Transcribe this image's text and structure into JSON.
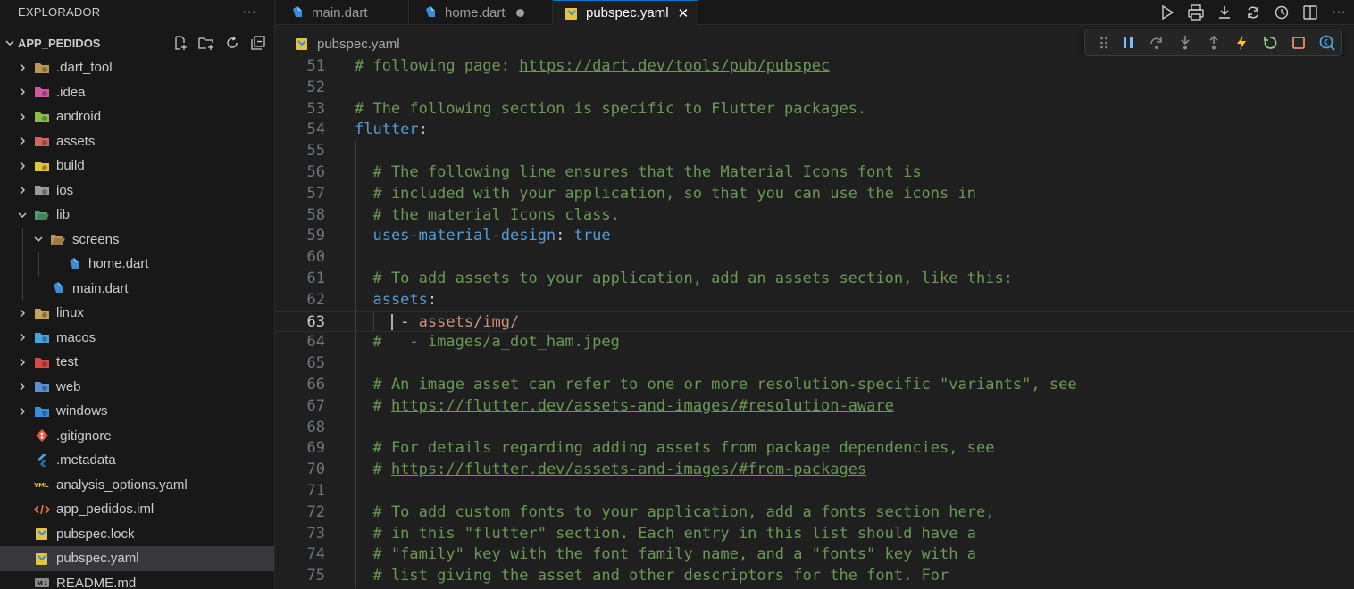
{
  "sidebar": {
    "title": "EXPLORADOR",
    "project": "APP_PEDIDOS",
    "tree": [
      {
        "label": ".dart_tool",
        "icon": "folder-tools-icon",
        "color": "#c09553"
      },
      {
        "label": ".idea",
        "icon": "folder-idea-icon",
        "color": "#c95b9e"
      },
      {
        "label": "android",
        "icon": "folder-android-icon",
        "color": "#8cbd4a"
      },
      {
        "label": "assets",
        "icon": "folder-assets-icon",
        "color": "#d66363"
      },
      {
        "label": "build",
        "icon": "folder-build-icon",
        "color": "#e6c241"
      },
      {
        "label": "ios",
        "icon": "folder-ios-icon",
        "color": "#9a9a9a"
      },
      {
        "label": "lib",
        "icon": "folder-lib-open-icon",
        "color": "#4fa06b"
      },
      {
        "label": "screens",
        "icon": "folder-open-icon",
        "color": "#c09553"
      },
      {
        "label": "home.dart",
        "icon": "dart-icon",
        "color": "#3a8ddb"
      },
      {
        "label": "main.dart",
        "icon": "dart-icon",
        "color": "#3a8ddb"
      },
      {
        "label": "linux",
        "icon": "folder-linux-icon",
        "color": "#c9a25c"
      },
      {
        "label": "macos",
        "icon": "folder-macos-icon",
        "color": "#4aa3e0"
      },
      {
        "label": "test",
        "icon": "folder-test-icon",
        "color": "#d94848"
      },
      {
        "label": "web",
        "icon": "folder-web-icon",
        "color": "#5a8fd6"
      },
      {
        "label": "windows",
        "icon": "folder-windows-icon",
        "color": "#3a8ddb"
      },
      {
        "label": ".gitignore",
        "icon": "git-icon",
        "color": "#e8533d"
      },
      {
        "label": ".metadata",
        "icon": "flutter-icon",
        "color": "#45a5e6"
      },
      {
        "label": "analysis_options.yaml",
        "icon": "yaml-icon",
        "color": "#e6c241"
      },
      {
        "label": "app_pedidos.iml",
        "icon": "xml-icon",
        "color": "#e87a3d"
      },
      {
        "label": "pubspec.lock",
        "icon": "pubspec-icon",
        "color": "#e6c241"
      },
      {
        "label": "pubspec.yaml",
        "icon": "pubspec-icon",
        "color": "#e6c241"
      },
      {
        "label": "README.md",
        "icon": "markdown-icon",
        "color": "#8a8a8a"
      }
    ]
  },
  "tabs": [
    {
      "label": "main.dart",
      "icon": "dart-icon"
    },
    {
      "label": "home.dart",
      "icon": "dart-icon"
    },
    {
      "label": "pubspec.yaml",
      "icon": "pubspec-icon"
    }
  ],
  "breadcrumb": "pubspec.yaml",
  "editor": {
    "current_line": "63",
    "lines": [
      {
        "n": "51",
        "parts": [
          {
            "t": "# following page: ",
            "c": "com"
          },
          {
            "t": "https://dart.dev/tools/pub/pubspec",
            "c": "link"
          }
        ]
      },
      {
        "n": "52",
        "parts": []
      },
      {
        "n": "53",
        "parts": [
          {
            "t": "# The following section is specific to Flutter packages.",
            "c": "com"
          }
        ]
      },
      {
        "n": "54",
        "parts": [
          {
            "t": "flutter",
            "c": "key"
          },
          {
            "t": ":",
            "c": "plain"
          }
        ]
      },
      {
        "n": "55",
        "parts": []
      },
      {
        "n": "56",
        "parts": [
          {
            "t": "  # The following line ensures that the Material Icons font is",
            "c": "com"
          }
        ]
      },
      {
        "n": "57",
        "parts": [
          {
            "t": "  # included with your application, so that you can use the icons in",
            "c": "com"
          }
        ]
      },
      {
        "n": "58",
        "parts": [
          {
            "t": "  # the material Icons class.",
            "c": "com"
          }
        ]
      },
      {
        "n": "59",
        "parts": [
          {
            "t": "  uses-material-design",
            "c": "key"
          },
          {
            "t": ": ",
            "c": "plain"
          },
          {
            "t": "true",
            "c": "bool"
          }
        ]
      },
      {
        "n": "60",
        "parts": []
      },
      {
        "n": "61",
        "parts": [
          {
            "t": "  # To add assets to your application, add an assets section, like this:",
            "c": "com"
          }
        ]
      },
      {
        "n": "62",
        "parts": [
          {
            "t": "  assets",
            "c": "key"
          },
          {
            "t": ":",
            "c": "plain"
          }
        ]
      },
      {
        "n": "63",
        "parts": [
          {
            "t": "     - ",
            "c": "plain"
          },
          {
            "t": "assets/img/",
            "c": "str"
          }
        ]
      },
      {
        "n": "64",
        "parts": [
          {
            "t": "  #   - images/a_dot_ham.jpeg",
            "c": "com"
          }
        ]
      },
      {
        "n": "65",
        "parts": []
      },
      {
        "n": "66",
        "parts": [
          {
            "t": "  # An image asset can refer to one or more resolution-specific \"variants\", see",
            "c": "com"
          }
        ]
      },
      {
        "n": "67",
        "parts": [
          {
            "t": "  # ",
            "c": "com"
          },
          {
            "t": "https://flutter.dev/assets-and-images/#resolution-aware",
            "c": "link"
          }
        ]
      },
      {
        "n": "68",
        "parts": []
      },
      {
        "n": "69",
        "parts": [
          {
            "t": "  # For details regarding adding assets from package dependencies, see",
            "c": "com"
          }
        ]
      },
      {
        "n": "70",
        "parts": [
          {
            "t": "  # ",
            "c": "com"
          },
          {
            "t": "https://flutter.dev/assets-and-images/#from-packages",
            "c": "link"
          }
        ]
      },
      {
        "n": "71",
        "parts": []
      },
      {
        "n": "72",
        "parts": [
          {
            "t": "  # To add custom fonts to your application, add a fonts section here,",
            "c": "com"
          }
        ]
      },
      {
        "n": "73",
        "parts": [
          {
            "t": "  # in this \"flutter\" section. Each entry in this list should have a",
            "c": "com"
          }
        ]
      },
      {
        "n": "74",
        "parts": [
          {
            "t": "  # \"family\" key with the font family name, and a \"fonts\" key with a",
            "c": "com"
          }
        ]
      },
      {
        "n": "75",
        "parts": [
          {
            "t": "  # list giving the asset and other descriptors for the font. For",
            "c": "com"
          }
        ]
      }
    ]
  },
  "colors": {
    "accent": "#0078d4",
    "debug_pause": "#75beff",
    "debug_restart": "#89d185",
    "debug_stop": "#f48771",
    "debug_hot_reload": "#ffcc00"
  }
}
